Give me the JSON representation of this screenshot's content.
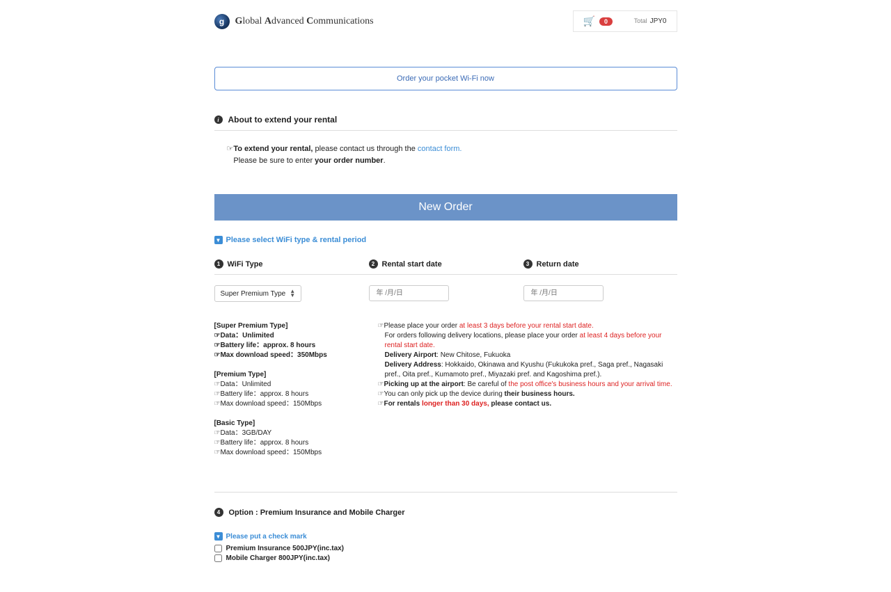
{
  "header": {
    "company_name": "Global Advanced Communications",
    "cart": {
      "count": "0",
      "total_label": "Total",
      "total_value": "JPY0"
    }
  },
  "banner": {
    "order_now": "Order your pocket Wi-Fi now"
  },
  "extend": {
    "title": "About to extend your rental",
    "pointer": "☞",
    "strong1": "To extend your rental,",
    "text1": " please contact us through the ",
    "link": "contact form.",
    "text2": "Please be sure to enter ",
    "strong2": "your order number",
    "punct": "."
  },
  "new_order": {
    "title": "New Order"
  },
  "step1_hint": "Please select WiFi type & rental period",
  "columns": {
    "c1": {
      "num": "1",
      "label": "WiFi Type"
    },
    "c2": {
      "num": "2",
      "label": "Rental start date"
    },
    "c3": {
      "num": "3",
      "label": "Return date"
    }
  },
  "inputs": {
    "wifi_type": "Super Premium Type",
    "date_placeholder": "年 /月/日"
  },
  "types": {
    "sp": {
      "title": "[Super Premium Type]",
      "l1": "☞Data：Unlimited",
      "l2": "☞Battery life：approx. 8 hours",
      "l3": "☞Max download speed：350Mbps"
    },
    "pr": {
      "title": "[Premium Type]",
      "l1": "☞Data：Unlimited",
      "l2": "☞Battery life：approx. 8 hours",
      "l3": "☞Max download speed：150Mbps"
    },
    "ba": {
      "title": "[Basic Type]",
      "l1": "☞Data：3GB/DAY",
      "l2": "☞Battery life：approx. 8 hours",
      "l3": "☞Max download speed：150Mbps"
    }
  },
  "notes": {
    "n1a": "☞Please place your order ",
    "n1b": "at least 3 days before your rental start date.",
    "n2a": "For orders following delivery locations, please place your order ",
    "n2b": "at least 4 days before your rental start date.",
    "n3a": "Delivery Airport",
    "n3b": ": New Chitose, Fukuoka",
    "n4a": "Delivery Address",
    "n4b": ": Hokkaido, Okinawa and Kyushu (Fukukoka pref., Saga pref., Nagasaki pref., Oita pref., Kumamoto pref., Miyazaki pref. and Kagoshima pref.).",
    "n5a": "☞",
    "n5b": "Picking up at the airport",
    "n5c": ": Be careful of ",
    "n5d": "the post office's business hours and your arrival time.",
    "n6a": "☞You can only pick up the device during ",
    "n6b": "their business hours.",
    "n7a": "☞",
    "n7b": "For rentals ",
    "n7c": "longer than 30 days,",
    "n7d": " please contact us."
  },
  "option": {
    "num": "4",
    "title": "Option : Premium Insurance and Mobile Charger",
    "hint": "Please put a check mark",
    "opt1": "Premium Insurance 500JPY(inc.tax)",
    "opt2": "Mobile Charger 800JPY(inc.tax)"
  }
}
